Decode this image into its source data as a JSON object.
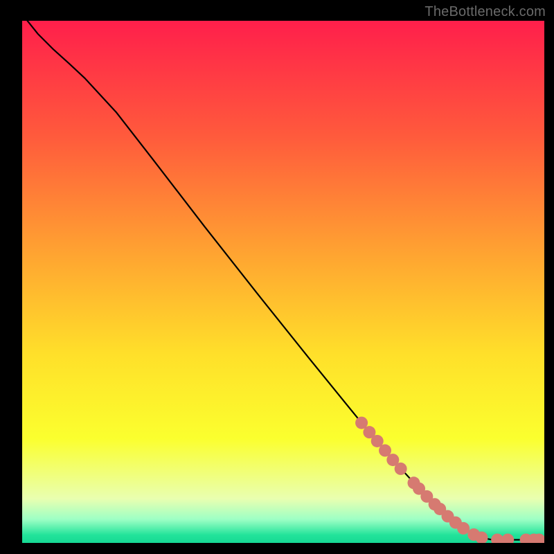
{
  "attribution": "TheBottleneck.com",
  "chart_data": {
    "type": "line",
    "title": "",
    "xlabel": "",
    "ylabel": "",
    "xlim": [
      0,
      100
    ],
    "ylim": [
      0,
      100
    ],
    "grid": false,
    "legend": false,
    "gradient_stops": [
      {
        "offset": 0.0,
        "color": "#ff1f4b"
      },
      {
        "offset": 0.22,
        "color": "#ff5a3c"
      },
      {
        "offset": 0.45,
        "color": "#ffa531"
      },
      {
        "offset": 0.64,
        "color": "#ffe02a"
      },
      {
        "offset": 0.8,
        "color": "#fbff2e"
      },
      {
        "offset": 0.915,
        "color": "#e9ffb0"
      },
      {
        "offset": 0.955,
        "color": "#9dffc5"
      },
      {
        "offset": 0.985,
        "color": "#22e39a"
      },
      {
        "offset": 1.0,
        "color": "#17d994"
      }
    ],
    "series": [
      {
        "name": "curve",
        "color": "#000000",
        "points": [
          {
            "x": 1.0,
            "y": 100.0
          },
          {
            "x": 3.0,
            "y": 97.5
          },
          {
            "x": 6.0,
            "y": 94.5
          },
          {
            "x": 9.0,
            "y": 91.8
          },
          {
            "x": 12.0,
            "y": 89.0
          },
          {
            "x": 18.0,
            "y": 82.5
          },
          {
            "x": 25.0,
            "y": 73.5
          },
          {
            "x": 35.0,
            "y": 60.5
          },
          {
            "x": 45.0,
            "y": 47.8
          },
          {
            "x": 55.0,
            "y": 35.3
          },
          {
            "x": 65.0,
            "y": 23.0
          },
          {
            "x": 72.0,
            "y": 14.8
          },
          {
            "x": 78.0,
            "y": 8.3
          },
          {
            "x": 82.0,
            "y": 4.7
          },
          {
            "x": 85.0,
            "y": 2.5
          },
          {
            "x": 88.0,
            "y": 1.0
          },
          {
            "x": 90.0,
            "y": 0.6
          },
          {
            "x": 95.0,
            "y": 0.6
          },
          {
            "x": 99.0,
            "y": 0.6
          }
        ]
      }
    ],
    "markers": {
      "color": "#d67a71",
      "radius_px": 9,
      "points": [
        {
          "x": 65.0,
          "y": 23.0
        },
        {
          "x": 66.5,
          "y": 21.2
        },
        {
          "x": 68.0,
          "y": 19.5
        },
        {
          "x": 69.5,
          "y": 17.7
        },
        {
          "x": 71.0,
          "y": 15.9
        },
        {
          "x": 72.5,
          "y": 14.2
        },
        {
          "x": 75.0,
          "y": 11.5
        },
        {
          "x": 76.0,
          "y": 10.4
        },
        {
          "x": 77.5,
          "y": 8.9
        },
        {
          "x": 79.0,
          "y": 7.4
        },
        {
          "x": 80.0,
          "y": 6.5
        },
        {
          "x": 81.5,
          "y": 5.1
        },
        {
          "x": 83.0,
          "y": 3.9
        },
        {
          "x": 84.5,
          "y": 2.8
        },
        {
          "x": 86.5,
          "y": 1.6
        },
        {
          "x": 88.0,
          "y": 1.0
        },
        {
          "x": 91.0,
          "y": 0.6
        },
        {
          "x": 93.0,
          "y": 0.6
        },
        {
          "x": 96.5,
          "y": 0.6
        },
        {
          "x": 98.0,
          "y": 0.6
        },
        {
          "x": 99.0,
          "y": 0.6
        }
      ]
    }
  }
}
